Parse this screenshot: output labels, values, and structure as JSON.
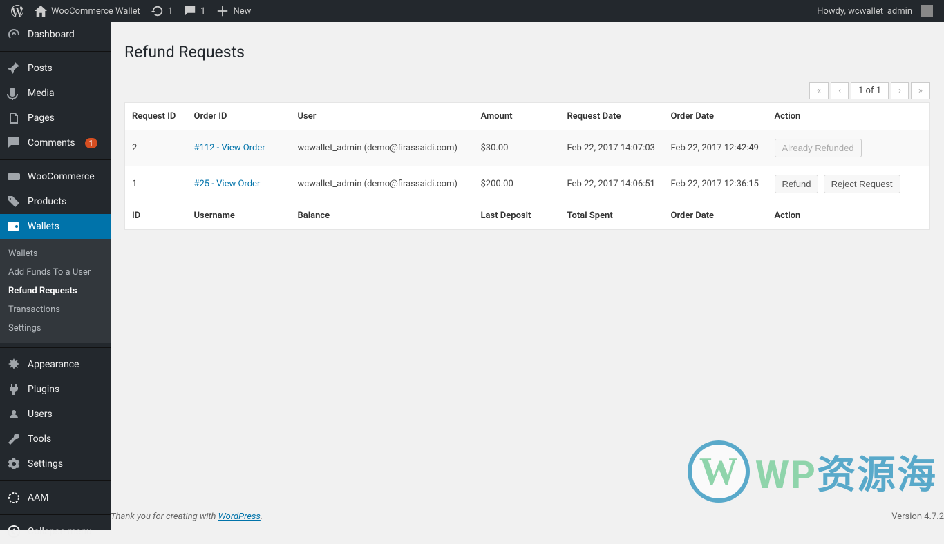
{
  "adminbar": {
    "site_title": "WooCommerce Wallet",
    "updates_count": "1",
    "comments_count": "1",
    "new_label": "New",
    "howdy": "Howdy, wcwallet_admin"
  },
  "sidebar": {
    "dashboard": "Dashboard",
    "posts": "Posts",
    "media": "Media",
    "pages": "Pages",
    "comments": "Comments",
    "comments_badge": "1",
    "woocommerce": "WooCommerce",
    "products": "Products",
    "wallets": "Wallets",
    "submenu": {
      "wallets": "Wallets",
      "add_funds": "Add Funds To a User",
      "refund_requests": "Refund Requests",
      "transactions": "Transactions",
      "settings": "Settings"
    },
    "appearance": "Appearance",
    "plugins": "Plugins",
    "users": "Users",
    "tools": "Tools",
    "settings": "Settings",
    "aam": "AAM",
    "collapse": "Collapse menu"
  },
  "page": {
    "title": "Refund Requests",
    "pager": {
      "first": "«",
      "prev": "‹",
      "info": "1 of 1",
      "next": "›",
      "last": "»"
    },
    "columns": {
      "request_id": "Request ID",
      "order_id": "Order ID",
      "user": "User",
      "amount": "Amount",
      "request_date": "Request Date",
      "order_date": "Order Date",
      "action": "Action"
    },
    "rows": [
      {
        "request_id": "2",
        "order_link": "#112 - View Order",
        "user": "wcwallet_admin (demo@firassaidi.com)",
        "amount": "$30.00",
        "request_date": "Feb 22, 2017 14:07:03",
        "order_date": "Feb 22, 2017 12:42:49",
        "action_refunded": "Already Refunded"
      },
      {
        "request_id": "1",
        "order_link": "#25 - View Order",
        "user": "wcwallet_admin (demo@firassaidi.com)",
        "amount": "$200.00",
        "request_date": "Feb 22, 2017 14:06:51",
        "order_date": "Feb 22, 2017 12:36:15",
        "action_refund": "Refund",
        "action_reject": "Reject Request"
      }
    ],
    "footer_cols": {
      "id": "ID",
      "username": "Username",
      "balance": "Balance",
      "last_deposit": "Last Deposit",
      "total_spent": "Total Spent",
      "order_date": "Order Date",
      "action": "Action"
    }
  },
  "footer": {
    "thanks_prefix": "Thank you for creating with ",
    "wp_link": "WordPress",
    "thanks_suffix": ".",
    "version": "Version 4.7.2"
  },
  "watermark": {
    "logo_letter": "W",
    "text_wp": "WP",
    "text_cn": "资源海"
  }
}
